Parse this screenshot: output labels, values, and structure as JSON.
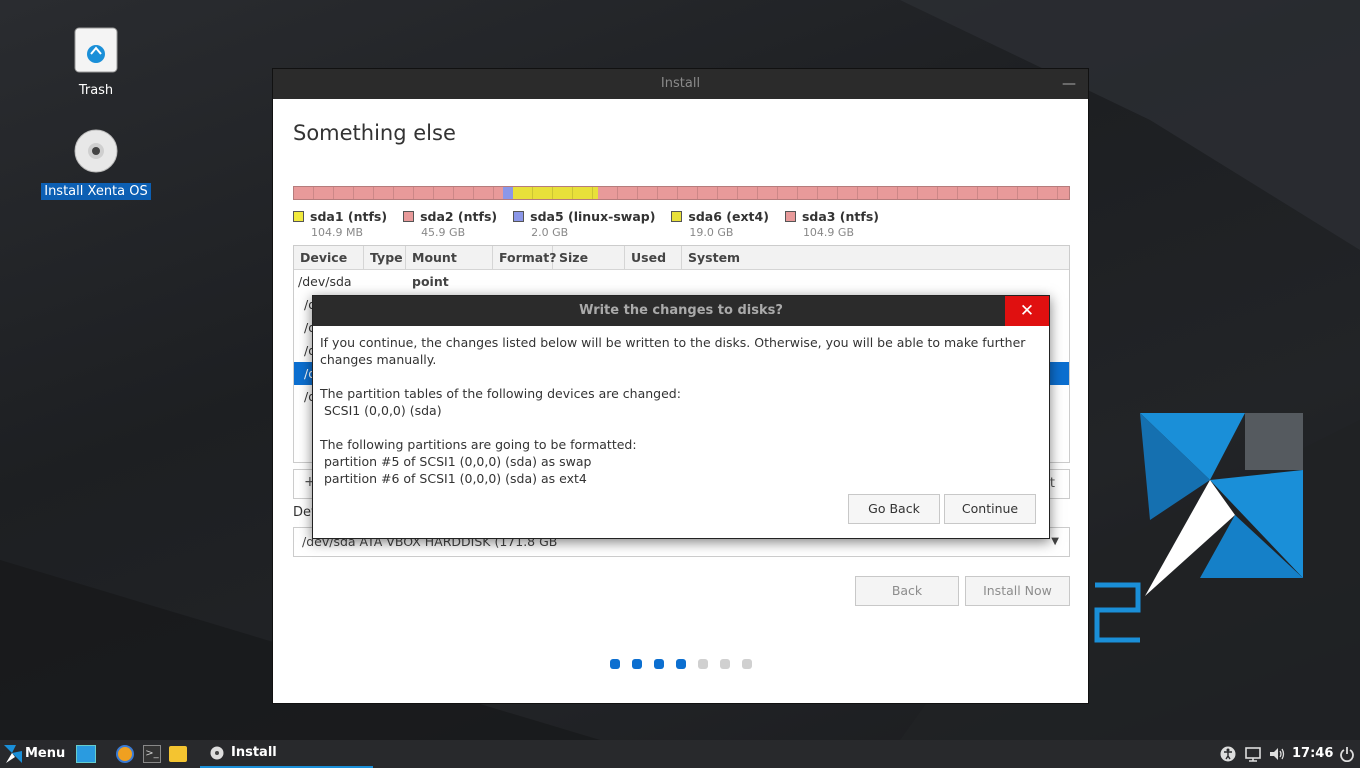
{
  "desktop": {
    "icons": [
      {
        "label": "Trash",
        "icon": "trash-icon"
      },
      {
        "label": "Install Xenta OS",
        "icon": "cd-icon"
      }
    ]
  },
  "installer": {
    "title": "Install",
    "minimize": "—",
    "heading": "Something else",
    "partitions": [
      {
        "name": "sda1 (ntfs)",
        "size": "104.9 MB",
        "color": "#f1ea3d"
      },
      {
        "name": "sda2 (ntfs)",
        "size": "45.9 GB",
        "color": "#e89a9a"
      },
      {
        "name": "sda5 (linux-swap)",
        "size": "2.0 GB",
        "color": "#8b97e8"
      },
      {
        "name": "sda6 (ext4)",
        "size": "19.0 GB",
        "color": "#e8e03a"
      },
      {
        "name": "sda3 (ntfs)",
        "size": "104.9 GB",
        "color": "#e89a9a"
      }
    ],
    "table_headers": [
      "Device",
      "Type",
      "Mount point",
      "Format?",
      "Size",
      "Used",
      "System"
    ],
    "table_rows": [
      "/dev/sda",
      "/d",
      "/d",
      "/d",
      "/d",
      "/d"
    ],
    "selected_row": 4,
    "toolbar_plus": "+",
    "toolbar_tail": "t",
    "boot_label": "Dev",
    "boot_value": "/dev/sda   ATA VBOX HARDDISK (171.8 GB",
    "back_button": "Back",
    "install_button": "Install Now",
    "progress": {
      "completed_steps": 4,
      "total_steps": 7
    }
  },
  "dialog": {
    "title": "Write the changes to disks?",
    "close": "✕",
    "intro": "If you continue, the changes listed below will be written to the disks. Otherwise, you will be able to make further changes manually.",
    "tables_heading": "The partition tables of the following devices are changed:",
    "tables_items": [
      " SCSI1 (0,0,0) (sda)"
    ],
    "format_heading": "The following partitions are going to be formatted:",
    "format_items": [
      " partition #5 of SCSI1 (0,0,0) (sda) as swap",
      " partition #6 of SCSI1 (0,0,0) (sda) as ext4"
    ],
    "go_back": "Go Back",
    "continue": "Continue"
  },
  "taskbar": {
    "menu": "Menu",
    "active_window": "Install",
    "clock": "17:46"
  },
  "colors": {
    "accent": "#0c6fd0",
    "close_red": "#e01010",
    "dot_active": "#0c6fd0",
    "dot_inactive": "#d0d0d0"
  }
}
